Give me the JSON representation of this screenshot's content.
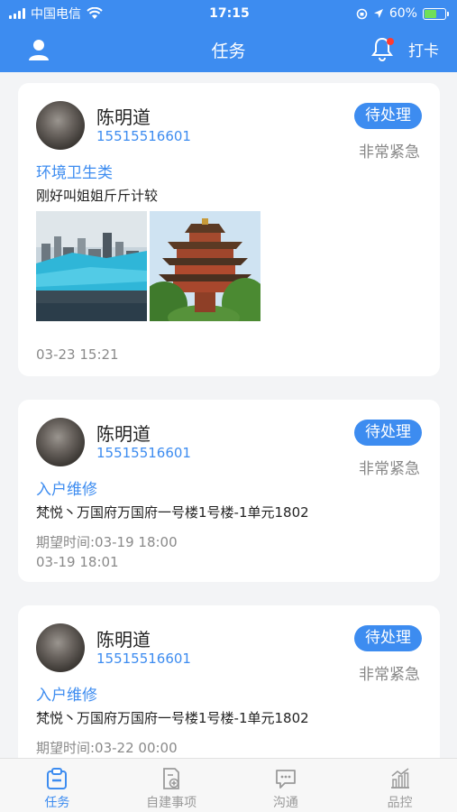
{
  "status_bar": {
    "carrier": "中国电信",
    "time": "17:15",
    "battery": "60%",
    "battery_level": 0.6
  },
  "nav": {
    "title": "任务",
    "punch_label": "打卡"
  },
  "tasks": [
    {
      "name": "陈明道",
      "phone": "15515516601",
      "status": "待处理",
      "urgency": "非常紧急",
      "category": "环境卫生类",
      "description": "刚好叫姐姐斤斤计较",
      "time": "03-23 15:21"
    },
    {
      "name": "陈明道",
      "phone": "15515516601",
      "status": "待处理",
      "urgency": "非常紧急",
      "category": "入户维修",
      "description": "梵悦丶万国府万国府一号楼1号楼-1单元1802",
      "expected": "期望时间:03-19 18:00",
      "time": "03-19 18:01"
    },
    {
      "name": "陈明道",
      "phone": "15515516601",
      "status": "待处理",
      "urgency": "非常紧急",
      "category": "入户维修",
      "description": "梵悦丶万国府万国府一号楼1号楼-1单元1802",
      "expected": "期望时间:03-22 00:00"
    }
  ],
  "tabs": [
    {
      "label": "任务",
      "icon": "task-icon",
      "active": true
    },
    {
      "label": "自建事项",
      "icon": "create-item-icon"
    },
    {
      "label": "沟通",
      "icon": "chat-icon"
    },
    {
      "label": "品控",
      "icon": "quality-chart-icon"
    }
  ],
  "colors": {
    "primary": "#3d8cf0",
    "background": "#f3f4f6"
  }
}
